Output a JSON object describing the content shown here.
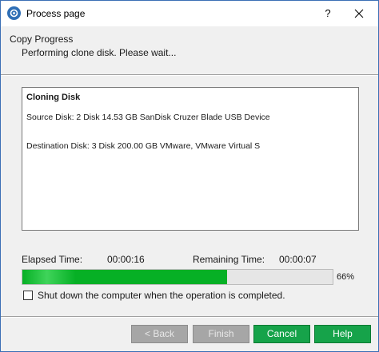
{
  "window": {
    "title": "Process page",
    "help_label": "?",
    "icon": "app-logo-icon",
    "close_icon": "close-icon"
  },
  "header": {
    "title": "Copy Progress",
    "subtitle": "Performing clone disk. Please wait..."
  },
  "info": {
    "title": "Cloning Disk",
    "source": "Source Disk: 2 Disk 14.53 GB SanDisk Cruzer Blade USB Device",
    "destination": "Destination Disk: 3 Disk 200.00 GB VMware, VMware Virtual S"
  },
  "times": {
    "elapsed_label": "Elapsed Time:",
    "elapsed_value": "00:00:16",
    "remaining_label": "Remaining Time:",
    "remaining_value": "00:00:07"
  },
  "progress": {
    "percent": 66,
    "percent_label": "66%",
    "fill_color": "#06b025"
  },
  "shutdown": {
    "label": "Shut down the computer when the operation is completed.",
    "checked": false
  },
  "buttons": {
    "back": "< Back",
    "finish": "Finish",
    "cancel": "Cancel",
    "help": "Help"
  },
  "colors": {
    "accent_green": "#16a34a",
    "disabled_gray": "#a6a6a6",
    "title_icon_blue": "#2f6fb6"
  }
}
